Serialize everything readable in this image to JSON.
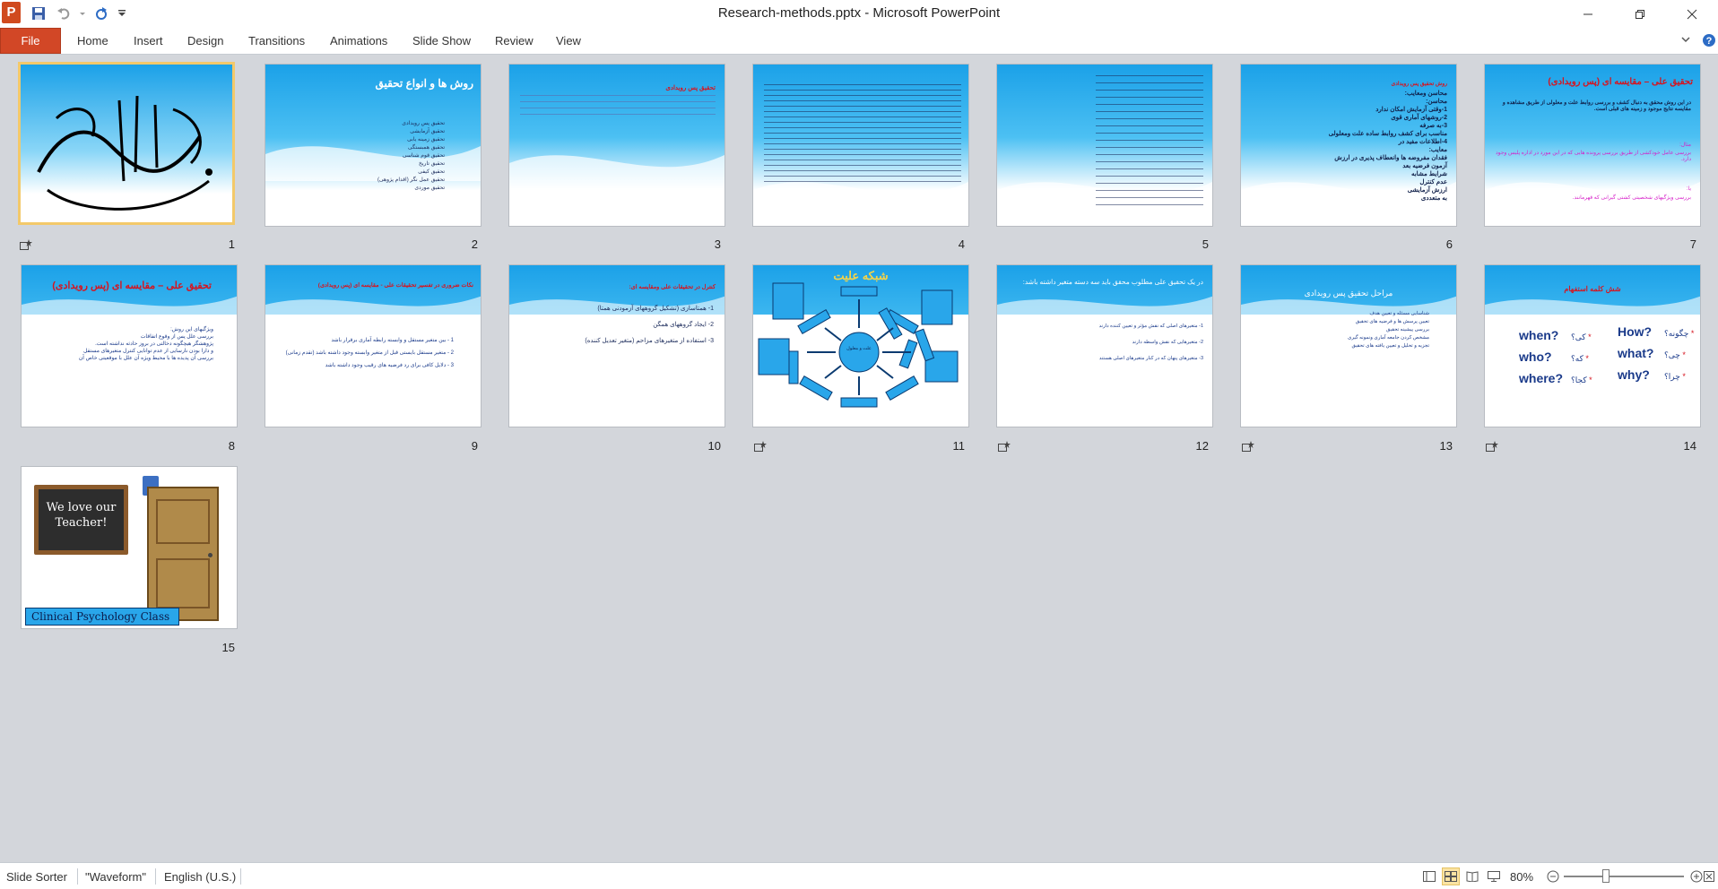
{
  "window": {
    "title": "Research-methods.pptx  -  Microsoft PowerPoint",
    "app_icon": "P"
  },
  "qat": {
    "icons": [
      "save-icon",
      "undo-icon",
      "redo-icon",
      "customize-icon"
    ]
  },
  "ribbon": {
    "file_label": "File",
    "tabs": [
      "Home",
      "Insert",
      "Design",
      "Transitions",
      "Animations",
      "Slide Show",
      "Review",
      "View"
    ]
  },
  "slides": [
    {
      "number": "1",
      "title": "",
      "lines": []
    },
    {
      "number": "2",
      "title": "روش ها و انواع تحقیق",
      "lines": [
        "تحقیق پس رویدادی",
        "تحقیق آزمایشی",
        "تحقیق زمینه یابی",
        "تحقیق همبستگی",
        "تحقیق قوم شناسی",
        "تحقیق تاریخ",
        "تحقیق کیفی",
        "تحقیق عمل نگر (اقدام پژوهی)",
        "تحقیق موردی"
      ]
    },
    {
      "number": "3",
      "title": "تحقیق پس رویدادی",
      "lines": []
    },
    {
      "number": "4",
      "title": "",
      "lines": []
    },
    {
      "number": "5",
      "title": "",
      "lines": []
    },
    {
      "number": "6",
      "title": "روش تحقیق پس رویدادی",
      "lines": [
        "محاسن ومعایب:",
        "محاسن:",
        "1-وقتی آزمایش امکان ندارد",
        "2-روشهای آماری قوی",
        "3-به صرفه",
        "مناسب برای کشف روابط ساده علت ومعلولی",
        "4-اطلاعات مفید در",
        "معایب:",
        "فقدان مفروضه ها وانعطاف پذیری در ارزش",
        "آزمون فرضیه بعد",
        "شرایط مشابه",
        "عدم کنترل",
        "ارزش آزمایشی",
        "به متعددی"
      ]
    },
    {
      "number": "7",
      "title": "تحقیق علی – مقایسه ای (پس رویدادی)",
      "lines": [
        "در این روش محقق به دنبال کشف و بررسی روابط علت و معلولی از طریق مشاهده و مقایسه نتایج موجود و زمینه های قبلی است.",
        "مثال:",
        "بررسی عامل خودکشی از طریق بررسی پرونده هایی که در این مورد در اداره پلیس وجود دارد.",
        "یا:",
        "بررسی ویژگیهای شخصیتی کشتی گیرانی که قهرمانند."
      ]
    },
    {
      "number": "8",
      "title": "تحقیق علی – مقایسه ای (پس رویدادی)",
      "lines": [
        "ویژگیهای این روش:",
        "بررسی علل پس از وقوع اتفاقات",
        "پژوهشگر هیچگونه دخالتی در بروز حادثه نداشته است.",
        "و دارا بودن نارسایی از عدم توانایی کنترل متغیرهای مستقل",
        "بررسی آن پدیده ها با محیط ویژه آن علل با موقعیتی خاص آن"
      ]
    },
    {
      "number": "9",
      "title": "نکات ضروری در تفسیر تحقیقات علی - مقایسه ای (پس رویدادی)",
      "lines": [
        "1 - بین متغیر مستقل و وابسته رابطه آماری برقرار باشد",
        "2 - متغیر مستقل بایستی قبل از متغیر وابسته وجود داشته باشد (تقدم زمانی)",
        "3 - دلایل کافی برای رد فرضیه های رقیب وجود داشته باشد"
      ]
    },
    {
      "number": "10",
      "title": "کنترل در تحقیقات علی ومقایسه ای:",
      "lines": [
        "1- همتاسازی (تشکیل گروههای آزمودنی همتا)",
        "2- ایجاد گروههای همگن",
        "3- استفاده از متغیرهای مزاحم (متغیر تعدیل کننده)"
      ]
    },
    {
      "number": "11",
      "title": "شبکه علیت",
      "lines": []
    },
    {
      "number": "12",
      "title": "در یک تحقیق علی مطلوب محقق باید سه دسته متغیر داشته باشد:",
      "lines": [
        "1- متغیرهای اصلی که نقش مؤثر و تعیین کننده دارند",
        "2- متغیرهایی که نقش واسطه دارند",
        "3- متغیرهای پنهان که در کنار متغیرهای اصلی هستند"
      ]
    },
    {
      "number": "13",
      "title": "مراحل تحقیق پس رویدادی",
      "lines": [
        "شناسایی مسئله و تعیین هدف",
        "تعیین پرسش ها و فرضیه های تحقیق",
        "بررسی پیشینه تحقیق",
        "مشخص کردن جامعه آماری ونمونه گیری",
        "تجزیه و تحلیل و تعیین یافته های تحقیق"
      ]
    },
    {
      "number": "14",
      "title": "شش کلمه استفهام",
      "lines": []
    },
    {
      "number": "15",
      "title": "",
      "lines": []
    }
  ],
  "slide1": {
    "calligraphy": "بسم الله الرحمن الرحیم"
  },
  "slide14": {
    "english": [
      "How?",
      "what?",
      "why?",
      "when?",
      "who?",
      "where?"
    ],
    "persian": [
      "چگونه؟",
      "چی؟",
      "چرا؟",
      "کی؟",
      "که؟",
      "کجا؟"
    ]
  },
  "slide15": {
    "board_text": "We love our Teacher!",
    "banner": "Clinical Psychology Class"
  },
  "slide11": {
    "center": "علت و معلول"
  },
  "status": {
    "view": "Slide Sorter",
    "theme": "\"Waveform\"",
    "language": "English (U.S.)",
    "zoom": "80%"
  },
  "colors": {
    "file_tab": "#d24726",
    "selected_border": "#f3c96a",
    "slide_blue": "#1ba1e8",
    "title_red": "#d6141f"
  }
}
